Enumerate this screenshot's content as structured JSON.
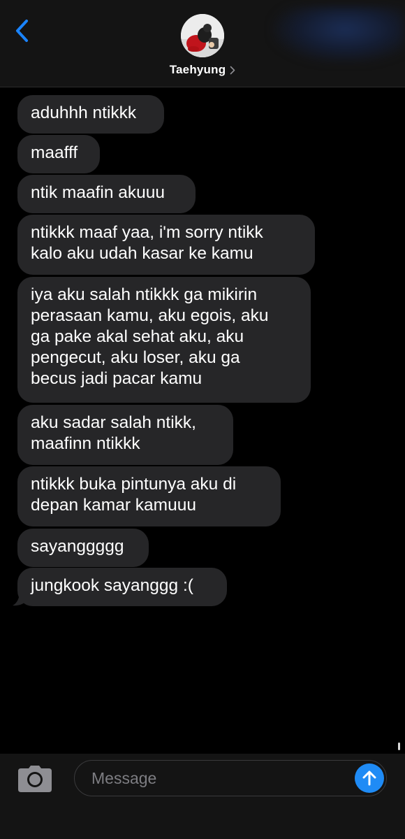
{
  "header": {
    "contact_name": "Taehyung",
    "accent_color": "#1a84ff",
    "back_icon": "chevron-left-icon",
    "disclosure_icon": "chevron-right-icon"
  },
  "messages": [
    {
      "lines": [
        "aduhhh ntikkk"
      ]
    },
    {
      "lines": [
        "maafff"
      ]
    },
    {
      "lines": [
        "ntik maafin akuuu"
      ]
    },
    {
      "lines": [
        "ntikkk maaf yaa, i'm sorry ntikk",
        "kalo aku udah kasar ke kamu"
      ]
    },
    {
      "lines": [
        "iya aku salah ntikkk ga mikirin",
        "perasaan kamu, aku egois, aku",
        "ga pake akal sehat aku, aku",
        "pengecut, aku loser, aku ga",
        "becus jadi pacar kamu"
      ]
    },
    {
      "lines": [
        "aku sadar salah ntikk,",
        "maafinn ntikkk"
      ]
    },
    {
      "lines": [
        "ntikkk buka pintunya aku di",
        "depan kamar kamuuu"
      ]
    },
    {
      "lines": [
        "sayanggggg"
      ]
    },
    {
      "lines": [
        "jungkook sayanggg :("
      ]
    }
  ],
  "composer": {
    "placeholder": "Message",
    "camera_icon": "camera-icon",
    "send_icon": "arrow-up-icon",
    "send_color": "#1f8bf5"
  }
}
